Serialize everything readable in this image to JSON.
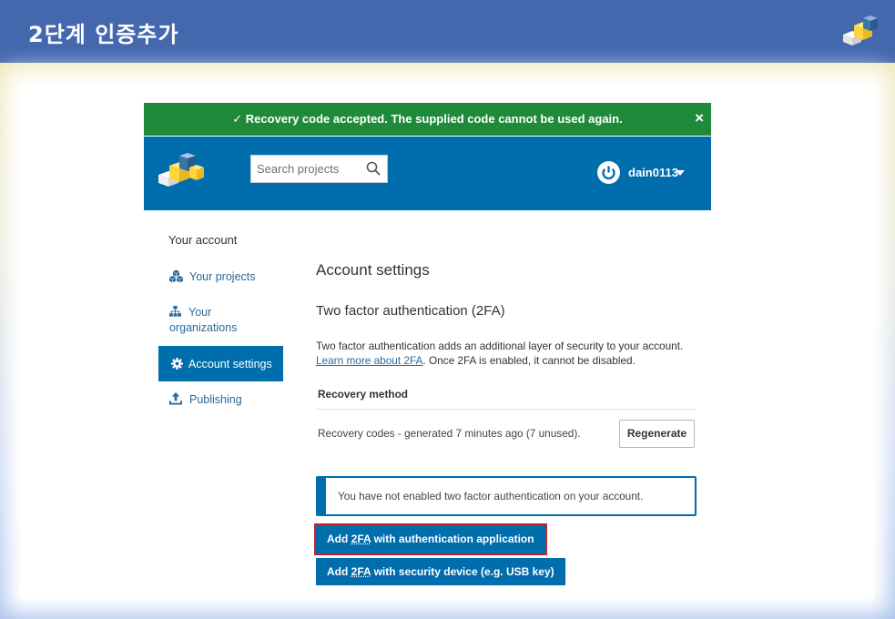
{
  "slide": {
    "title": "2단계 인증추가"
  },
  "flash": {
    "message": "✓ Recovery code accepted. The supplied code cannot be used again.",
    "close": "×"
  },
  "header": {
    "search_placeholder": "Search projects",
    "username": "dain0113"
  },
  "sidebar": {
    "heading": "Your account",
    "items": [
      {
        "label": "Your projects",
        "icon": "cubes-icon"
      },
      {
        "label": "Your",
        "label2": "organizations",
        "icon": "sitemap-icon"
      },
      {
        "label": "Account settings",
        "icon": "gear-icon",
        "active": true
      },
      {
        "label": "Publishing",
        "icon": "upload-icon"
      }
    ]
  },
  "main": {
    "title": "Account settings",
    "section_title": "Two factor authentication (2FA)",
    "description": "Two factor authentication adds an additional layer of security to your account.",
    "learn_more": "Learn more about 2FA",
    "description_tail": ". Once 2FA is enabled, it cannot be disabled.",
    "recovery_heading": "Recovery method",
    "recovery_status": "Recovery codes - generated 7 minutes ago (7 unused).",
    "regenerate_label": "Regenerate",
    "notice": "You have not enabled two factor authentication on your account.",
    "add_app_prefix": "Add ",
    "add_abbr": "2FA",
    "add_app_suffix": " with authentication application",
    "add_device_suffix": " with security device (e.g. USB key)"
  },
  "colors": {
    "slide_header": "#4467ad",
    "flash_green": "#1f8a3a",
    "pypi_blue": "#006dad",
    "highlight_red": "#c0262d"
  }
}
